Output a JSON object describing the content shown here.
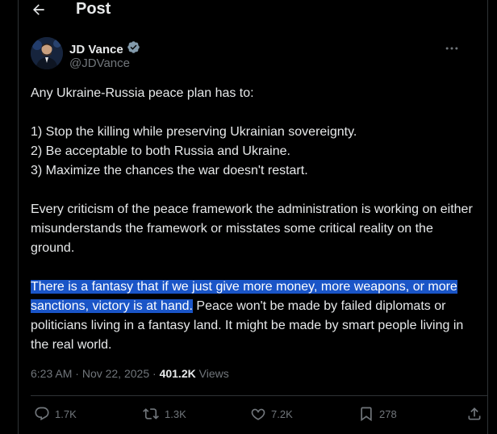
{
  "header": {
    "title": "Post",
    "back_icon": "arrow-left-icon"
  },
  "author": {
    "name": "JD Vance",
    "handle": "@JDVance",
    "verified_icon": "verified-badge-icon",
    "badge_color": "#829aab"
  },
  "more_icon": "more-horizontal-icon",
  "post": {
    "line1": "Any Ukraine-Russia peace plan has to:",
    "item1": "1) Stop the killing while preserving Ukrainian sovereignty.",
    "item2": "2) Be acceptable to both Russia and Ukraine.",
    "item3": "3) Maximize the chances the war doesn't restart.",
    "para2": "Every criticism of the peace framework the administration is working on either misunderstands the framework or misstates some critical reality on the ground.",
    "para3_highlighted": "There is a fantasy that if we just give more money, more weapons, or more sanctions, victory is at hand.",
    "para3_rest": " Peace won't be made by failed diplomats or politicians living in a fantasy land. It might be made by smart people living in the real world."
  },
  "meta": {
    "time": "6:23 AM",
    "sep1": " · ",
    "date": "Nov 22, 2025",
    "sep2": " · ",
    "views_count": "401.2K",
    "views_label": " Views"
  },
  "actions": {
    "replies": "1.7K",
    "reposts": "1.3K",
    "likes": "7.2K",
    "bookmarks": "278"
  },
  "colors": {
    "background": "#000000",
    "text": "#e7e9ea",
    "muted": "#71767b",
    "highlight": "#1a55c7",
    "border": "#2f3336"
  }
}
